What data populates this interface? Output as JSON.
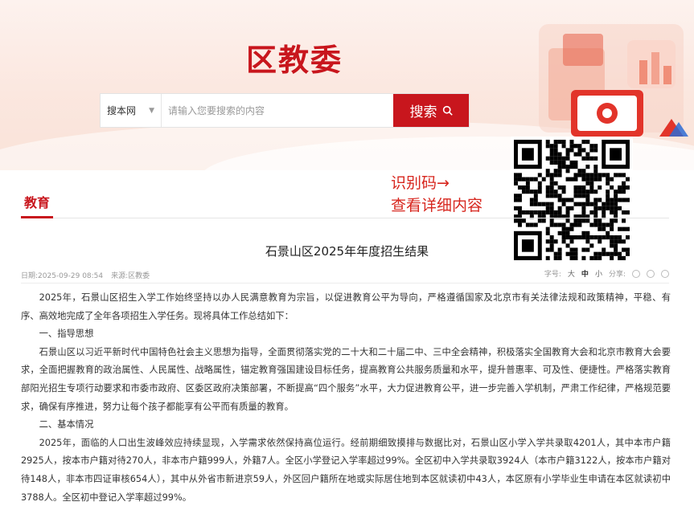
{
  "site": {
    "title": "区教委"
  },
  "search": {
    "scope": "搜本网",
    "placeholder": "请输入您要搜索的内容",
    "button": "搜索"
  },
  "qr": {
    "caption_line1": "识别码→",
    "caption_line2": "查看详细内容"
  },
  "channel": {
    "tab": "教育"
  },
  "article": {
    "title": "石景山区2025年年度招生结果",
    "date": "日期:2025-09-29 08:54",
    "source": "来源:区教委",
    "font_label": "字号:",
    "font_large": "大",
    "font_medium": "中",
    "font_small": "小",
    "share_label": "分享:",
    "paragraphs": [
      "2025年，石景山区招生入学工作始终坚持以办人民满意教育为宗旨，以促进教育公平为导向，严格遵循国家及北京市有关法律法规和政策精神，平稳、有序、高效地完成了全年各项招生入学任务。现将具体工作总结如下：",
      "一、指导思想",
      "石景山区以习近平新时代中国特色社会主义思想为指导，全面贯彻落实党的二十大和二十届二中、三中全会精神，积极落实全国教育大会和北京市教育大会要求，全面把握教育的政治属性、人民属性、战略属性，锚定教育强国建设目标任务，提高教育公共服务质量和水平，提升普惠率、可及性、便捷性。严格落实教育部阳光招生专项行动要求和市委市政府、区委区政府决策部署，不断提高“四个服务”水平，大力促进教育公平，进一步完善入学机制，严肃工作纪律，严格规范要求，确保有序推进，努力让每个孩子都能享有公平而有质量的教育。",
      "二、基本情况",
      "2025年，面临的人口出生波峰效应持续显现，入学需求依然保持高位运行。经前期细致摸排与数据比对，石景山区小学入学共录取4201人，其中本市户籍2925人，按本市户籍对待270人，非本市户籍999人，外籍7人。全区小学登记入学率超过99%。全区初中入学共录取3924人（本市户籍3122人，按本市户籍对待148人，非本市四证审核654人），其中从外省市新进京59人，外区回户籍所在地或实际居住地到本区就读初中43人，本区原有小学毕业生申请在本区就读初中3788人。全区初中登记入学率超过99%。"
    ]
  }
}
